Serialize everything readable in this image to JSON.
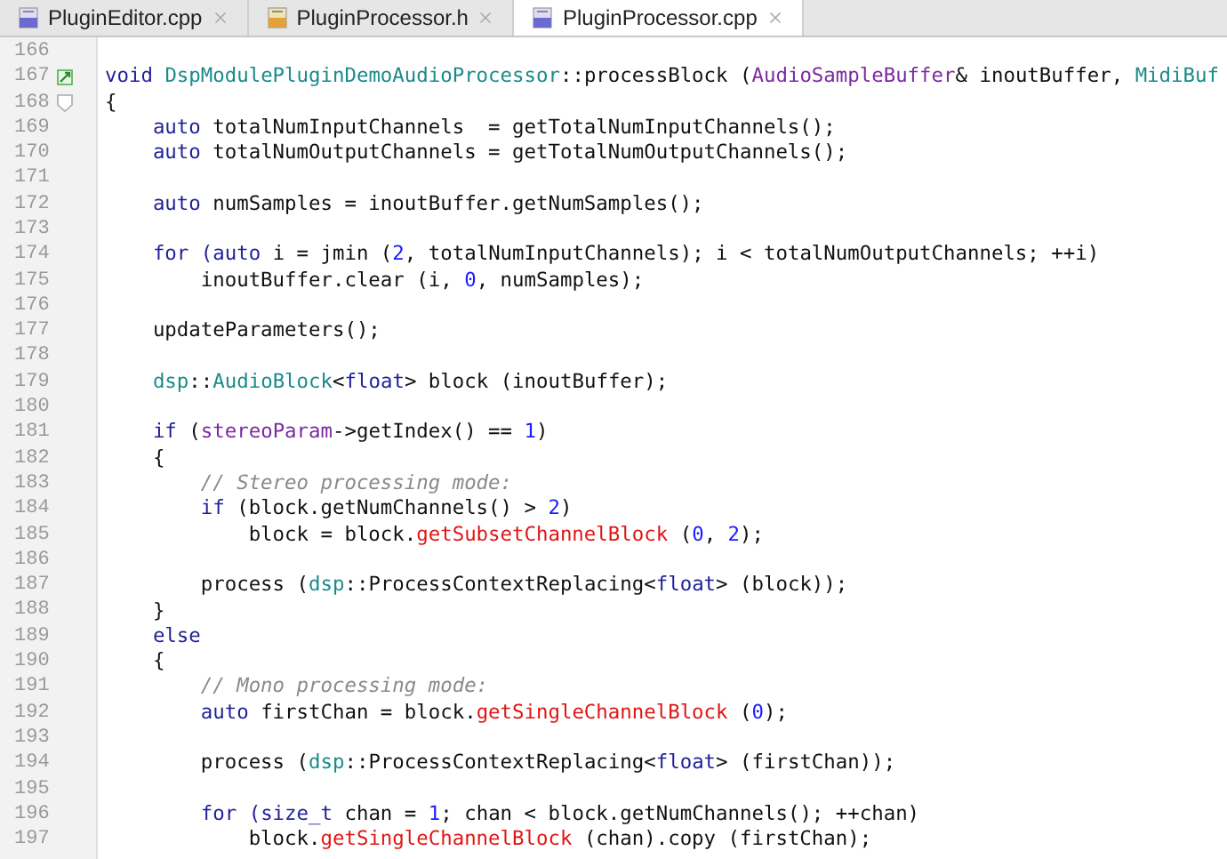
{
  "tabs": [
    {
      "label": "PluginEditor.cpp",
      "kind": "cpp",
      "selected": false
    },
    {
      "label": "PluginProcessor.h",
      "kind": "header",
      "selected": false
    },
    {
      "label": "PluginProcessor.cpp",
      "kind": "cpp",
      "selected": true
    }
  ],
  "editor": {
    "lines": [
      {
        "number": "166"
      },
      {
        "number": "167",
        "kind": "override",
        "segments": [
          {
            "kind": "keyword",
            "text": "void"
          },
          {
            "kind": "class",
            "text": " DspModulePluginDemoAudioProcessor"
          },
          {
            "kind": "plain",
            "text": "::processBlock ("
          },
          {
            "kind": "type",
            "text": "AudioSampleBuffer"
          },
          {
            "kind": "plain",
            "text": "& inoutBuffer, "
          },
          {
            "kind": "class",
            "text": "MidiBuf"
          }
        ]
      },
      {
        "number": "168",
        "kind": "fold",
        "segments": [
          {
            "kind": "plain",
            "text": "{"
          }
        ]
      },
      {
        "number": "169",
        "segments": [
          {
            "kind": "keyword",
            "text": "    auto"
          },
          {
            "kind": "plain",
            "text": " totalNumInputChannels  = getTotalNumInputChannels();"
          }
        ]
      },
      {
        "number": "170",
        "segments": [
          {
            "kind": "keyword",
            "text": "    auto"
          },
          {
            "kind": "plain",
            "text": " totalNumOutputChannels = getTotalNumOutputChannels();"
          }
        ]
      },
      {
        "number": "171"
      },
      {
        "number": "172",
        "segments": [
          {
            "kind": "keyword",
            "text": "    auto"
          },
          {
            "kind": "plain",
            "text": " numSamples = inoutBuffer.getNumSamples();"
          }
        ]
      },
      {
        "number": "173"
      },
      {
        "number": "174",
        "segments": [
          {
            "kind": "keyword",
            "text": "    for"
          },
          {
            "kind": "keyword",
            "text": " (auto"
          },
          {
            "kind": "plain",
            "text": " i = jmin ("
          },
          {
            "kind": "number",
            "text": "2"
          },
          {
            "kind": "plain",
            "text": ", totalNumInputChannels); i < totalNumOutputChannels; ++i)"
          }
        ]
      },
      {
        "number": "175",
        "segments": [
          {
            "kind": "plain",
            "text": "        inoutBuffer.clear (i, "
          },
          {
            "kind": "number",
            "text": "0"
          },
          {
            "kind": "plain",
            "text": ", numSamples);"
          }
        ]
      },
      {
        "number": "176"
      },
      {
        "number": "177",
        "segments": [
          {
            "kind": "plain",
            "text": "    updateParameters();"
          }
        ]
      },
      {
        "number": "178"
      },
      {
        "number": "179",
        "segments": [
          {
            "kind": "class",
            "text": "    dsp"
          },
          {
            "kind": "plain",
            "text": "::"
          },
          {
            "kind": "class",
            "text": "AudioBlock"
          },
          {
            "kind": "plain",
            "text": "<"
          },
          {
            "kind": "keyword",
            "text": "float"
          },
          {
            "kind": "plain",
            "text": "> block (inoutBuffer);"
          }
        ]
      },
      {
        "number": "180"
      },
      {
        "number": "181",
        "segments": [
          {
            "kind": "keyword",
            "text": "    if"
          },
          {
            "kind": "plain",
            "text": " ("
          },
          {
            "kind": "type",
            "text": "stereoParam"
          },
          {
            "kind": "plain",
            "text": "->getIndex() == "
          },
          {
            "kind": "number",
            "text": "1"
          },
          {
            "kind": "plain",
            "text": ")"
          }
        ]
      },
      {
        "number": "182",
        "segments": [
          {
            "kind": "plain",
            "text": "    {"
          }
        ]
      },
      {
        "number": "183",
        "segments": [
          {
            "kind": "comment",
            "text": "        // Stereo processing mode:"
          }
        ]
      },
      {
        "number": "184",
        "segments": [
          {
            "kind": "keyword",
            "text": "        if"
          },
          {
            "kind": "plain",
            "text": " (block.getNumChannels() > "
          },
          {
            "kind": "number",
            "text": "2"
          },
          {
            "kind": "plain",
            "text": ")"
          }
        ]
      },
      {
        "number": "185",
        "segments": [
          {
            "kind": "plain",
            "text": "            block = block."
          },
          {
            "kind": "method",
            "text": "getSubsetChannelBlock"
          },
          {
            "kind": "plain",
            "text": " ("
          },
          {
            "kind": "number",
            "text": "0"
          },
          {
            "kind": "plain",
            "text": ", "
          },
          {
            "kind": "number",
            "text": "2"
          },
          {
            "kind": "plain",
            "text": ");"
          }
        ]
      },
      {
        "number": "186"
      },
      {
        "number": "187",
        "segments": [
          {
            "kind": "plain",
            "text": "        process ("
          },
          {
            "kind": "class",
            "text": "dsp"
          },
          {
            "kind": "plain",
            "text": "::ProcessContextReplacing<"
          },
          {
            "kind": "keyword",
            "text": "float"
          },
          {
            "kind": "plain",
            "text": "> (block));"
          }
        ]
      },
      {
        "number": "188",
        "segments": [
          {
            "kind": "plain",
            "text": "    }"
          }
        ]
      },
      {
        "number": "189",
        "segments": [
          {
            "kind": "keyword",
            "text": "    else"
          }
        ]
      },
      {
        "number": "190",
        "segments": [
          {
            "kind": "plain",
            "text": "    {"
          }
        ]
      },
      {
        "number": "191",
        "segments": [
          {
            "kind": "comment",
            "text": "        // Mono processing mode:"
          }
        ]
      },
      {
        "number": "192",
        "segments": [
          {
            "kind": "keyword",
            "text": "        auto"
          },
          {
            "kind": "plain",
            "text": " firstChan = block."
          },
          {
            "kind": "method",
            "text": "getSingleChannelBlock"
          },
          {
            "kind": "plain",
            "text": " ("
          },
          {
            "kind": "number",
            "text": "0"
          },
          {
            "kind": "plain",
            "text": ");"
          }
        ]
      },
      {
        "number": "193"
      },
      {
        "number": "194",
        "segments": [
          {
            "kind": "plain",
            "text": "        process ("
          },
          {
            "kind": "class",
            "text": "dsp"
          },
          {
            "kind": "plain",
            "text": "::ProcessContextReplacing<"
          },
          {
            "kind": "keyword",
            "text": "float"
          },
          {
            "kind": "plain",
            "text": "> (firstChan));"
          }
        ]
      },
      {
        "number": "195"
      },
      {
        "number": "196",
        "segments": [
          {
            "kind": "keyword",
            "text": "        for"
          },
          {
            "kind": "keyword",
            "text": " (size_t"
          },
          {
            "kind": "plain",
            "text": " chan = "
          },
          {
            "kind": "number",
            "text": "1"
          },
          {
            "kind": "plain",
            "text": "; chan < block.getNumChannels(); ++chan)"
          }
        ]
      },
      {
        "number": "197",
        "segments": [
          {
            "kind": "plain",
            "text": "            block."
          },
          {
            "kind": "method",
            "text": "getSingleChannelBlock"
          },
          {
            "kind": "plain",
            "text": " (chan).copy (firstChan);"
          }
        ]
      }
    ]
  }
}
